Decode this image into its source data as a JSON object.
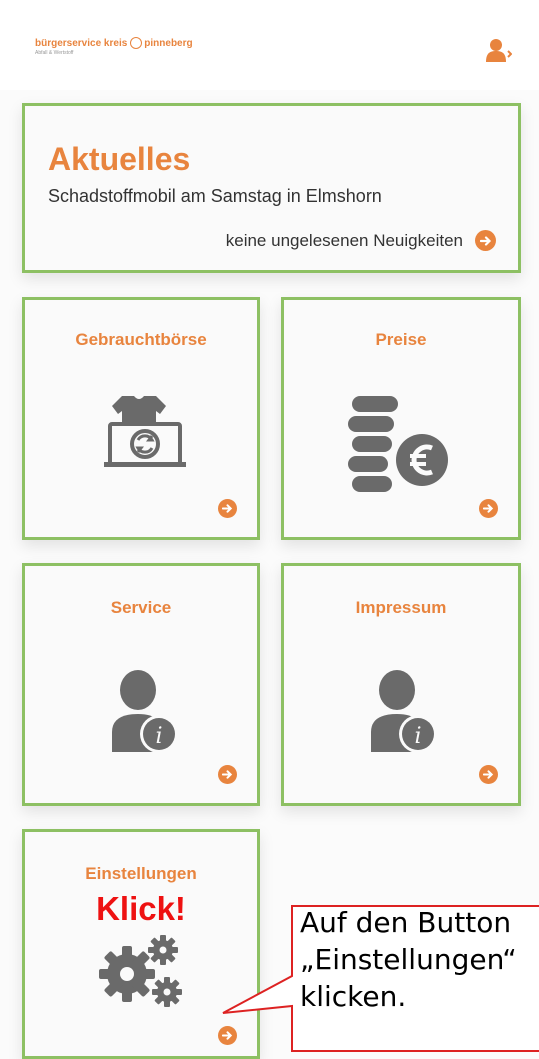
{
  "header": {
    "logo_main_left": "bürgerservice kreis",
    "logo_main_right": "pinneberg",
    "logo_sub": "Abfall & Wertstoff",
    "user_icon": "user-settings-icon"
  },
  "news": {
    "title": "Aktuelles",
    "text": "Schadstoffmobil am Samstag in Elmshorn",
    "status": "keine ungelesenen Neuigkeiten"
  },
  "tiles": [
    {
      "title": "Gebrauchtbörse",
      "icon": "second-hand-exchange-icon"
    },
    {
      "title": "Preise",
      "icon": "coins-euro-icon"
    },
    {
      "title": "Service",
      "icon": "user-info-icon"
    },
    {
      "title": "Impressum",
      "icon": "user-info-icon"
    },
    {
      "title": "Einstellungen",
      "icon": "gears-icon"
    }
  ],
  "annotation": {
    "klick": "Klick!",
    "callout_text": "Auf den Button „Einstellungen“ klicken."
  },
  "colors": {
    "accent": "#e8843e",
    "tile_border": "#8dc063",
    "icon_grey": "#6a6a6a",
    "annotation_red": "#ee1111"
  }
}
